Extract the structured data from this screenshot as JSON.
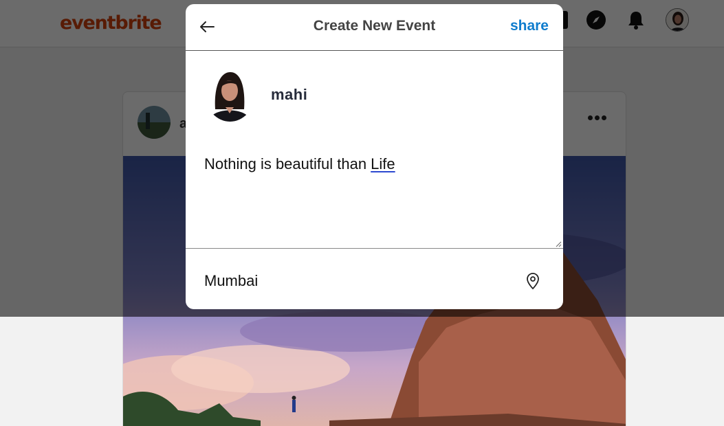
{
  "app": {
    "logo_text": "eventbrite",
    "brand_color": "#d1410c"
  },
  "navbar": {
    "icons": [
      "messenger-icon",
      "compass-icon",
      "bell-icon"
    ],
    "avatar": "profile-avatar"
  },
  "feed_post": {
    "username": "a",
    "more_icon": "more-horizontal-icon",
    "image": "temple-at-sunset-photo"
  },
  "modal": {
    "title": "Create New Event",
    "back_icon": "arrow-left-icon",
    "share_label": "share",
    "share_color": "#0f7ccd",
    "author_name": "mahi",
    "caption": {
      "value": "Nothing is beautiful than Life",
      "prefix": "Nothing is beautiful than ",
      "misspelled_word": "Life"
    },
    "location": {
      "value": "Mumbai",
      "icon": "location-pin-icon"
    }
  }
}
